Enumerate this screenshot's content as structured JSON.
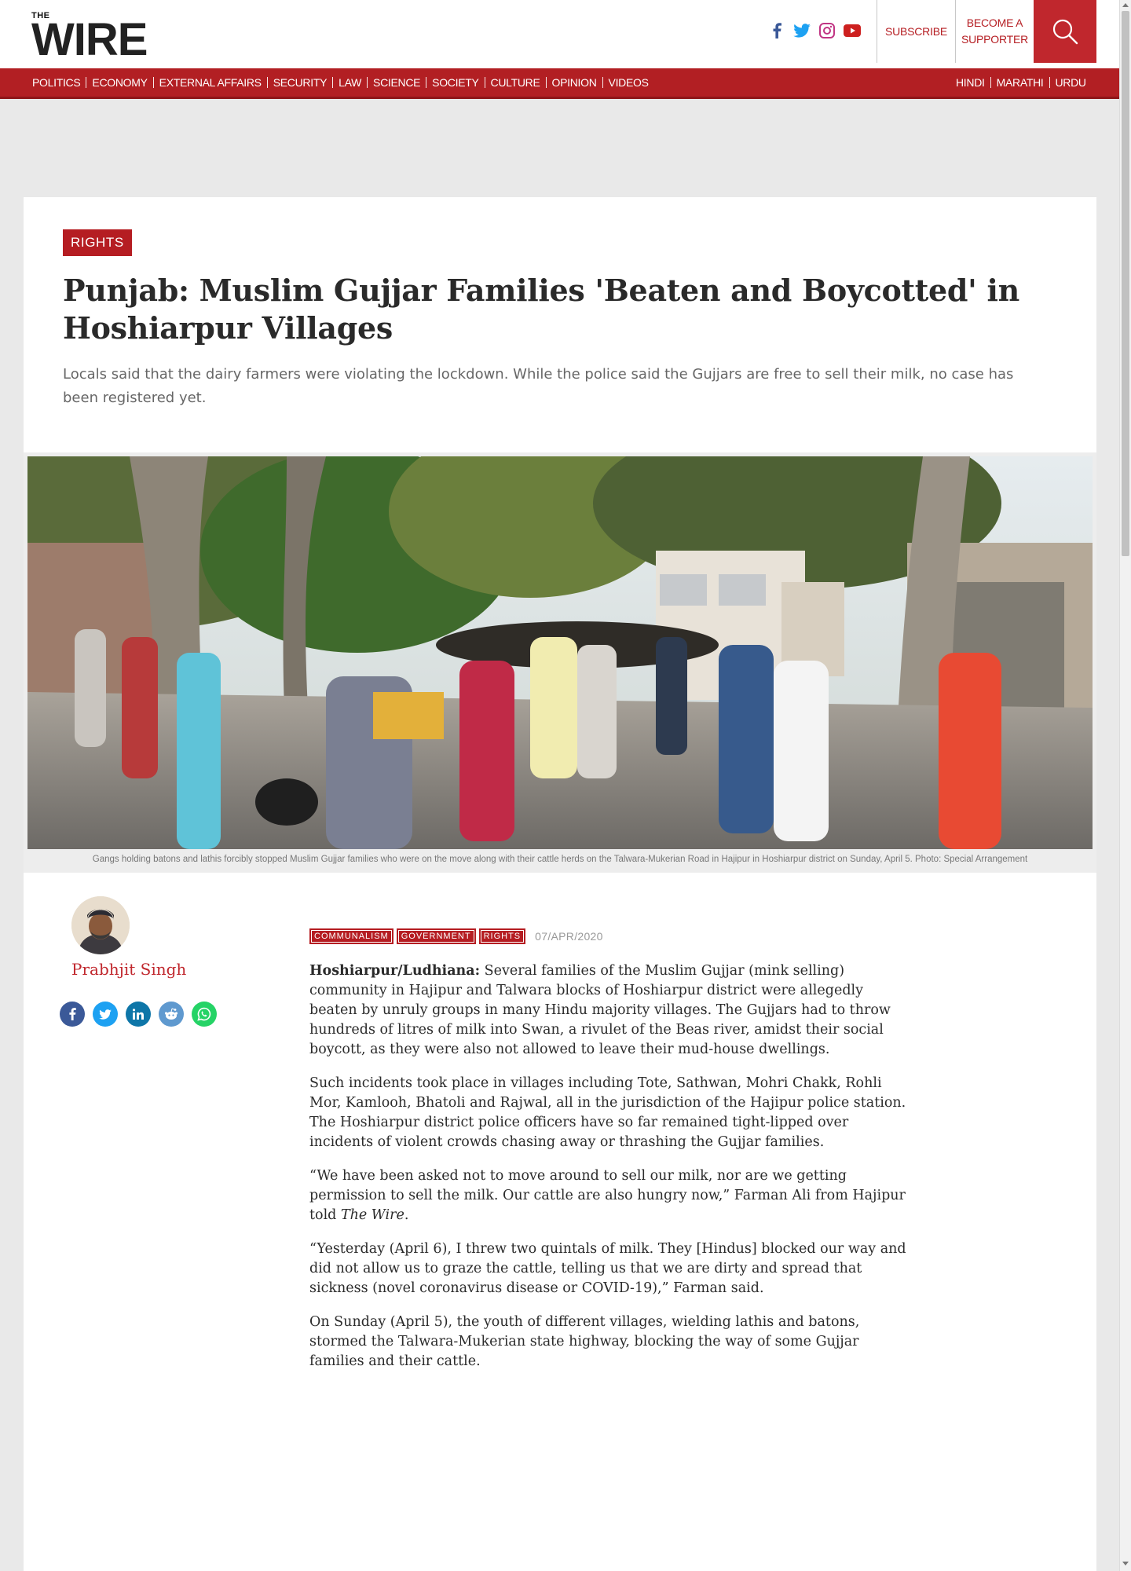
{
  "header": {
    "logo_small": "THE",
    "logo_big": "WIRE",
    "social_icons": [
      "facebook-icon",
      "twitter-icon",
      "instagram-icon",
      "youtube-icon"
    ],
    "subscribe": "SUBSCRIBE",
    "supporter_line1": "BECOME A",
    "supporter_line2": "SUPPORTER"
  },
  "nav": {
    "left": [
      "POLITICS",
      "ECONOMY",
      "EXTERNAL AFFAIRS",
      "SECURITY",
      "LAW",
      "SCIENCE",
      "SOCIETY",
      "CULTURE",
      "OPINION",
      "VIDEOS"
    ],
    "right": [
      "HINDI",
      "MARATHI",
      "URDU"
    ]
  },
  "colors": {
    "brand_red": "#b51d22",
    "nav_red": "#b21f23"
  },
  "article": {
    "category": "RIGHTS",
    "headline": "Punjab: Muslim Gujjar Families 'Beaten and Boycotted' in Hoshiarpur Villages",
    "standfirst": "Locals said that the dairy farmers were violating the lockdown. While the police said the Gujjars are free to sell their milk, no case has been registered yet.",
    "caption": "Gangs holding batons and lathis forcibly stopped Muslim Gujjar families who were on the move along with their cattle herds on the Talwara-Mukerian Road in Hajipur in Hoshiarpur district on Sunday, April 5. Photo: Special Arrangement",
    "author": "Prabhjit Singh",
    "share_icons": [
      "facebook-icon",
      "twitter-icon",
      "linkedin-icon",
      "reddit-icon",
      "whatsapp-icon"
    ],
    "tags": [
      "COMMUNALISM",
      "GOVERNMENT",
      "RIGHTS"
    ],
    "date": "07/APR/2020",
    "dateline": "Hoshiarpur/Ludhiana:",
    "p1": "Several families of the Muslim Gujjar (mink selling) community in Hajipur and Talwara blocks of Hoshiarpur district were allegedly beaten by unruly groups in many Hindu majority villages. The Gujjars had to throw hundreds of litres of milk into Swan, a rivulet of the Beas river, amidst their social boycott, as they were also not allowed to leave their mud-house dwellings.",
    "p2": "Such incidents took place in villages including Tote, Sathwan, Mohri Chakk, Rohli Mor, Kamlooh, Bhatoli and Rajwal, all in the jurisdiction of the Hajipur police station. The Hoshiarpur district police officers have so far remained tight-lipped over incidents of violent crowds chasing away or thrashing the Gujjar families.",
    "p3_a": "“We have been asked not to move around to sell our milk, nor are we getting permission to sell the milk. Our cattle are also hungry now,” Farman Ali from Hajipur told ",
    "p3_em": "The Wire",
    "p3_b": ".",
    "p4": "“Yesterday (April 6), I threw two quintals of milk. They [Hindus] blocked our way and did not allow us to graze the cattle, telling us that we are dirty and spread that sickness (novel coronavirus disease or COVID-19),” Farman said.",
    "p5": "On Sunday (April 5), the youth of different villages, wielding lathis and batons, stormed the Talwara-Mukerian state highway, blocking the way of some Gujjar families and their cattle."
  }
}
